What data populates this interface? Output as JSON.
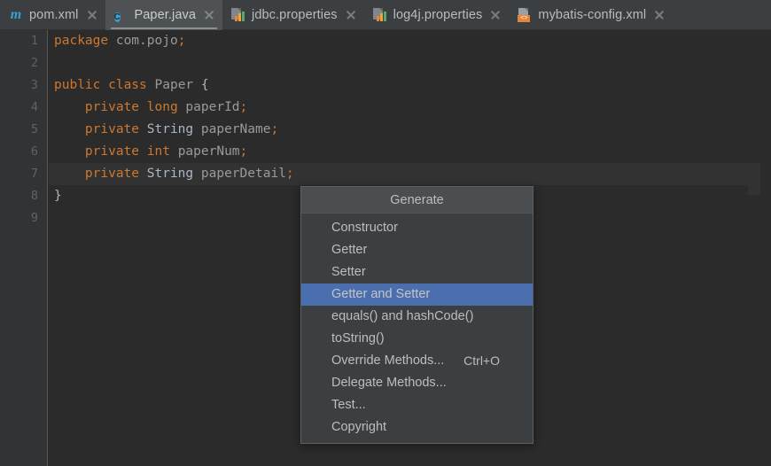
{
  "tabs": [
    {
      "label": "pom.xml",
      "icon": "maven-icon",
      "active": false
    },
    {
      "label": "Paper.java",
      "icon": "java-class-icon",
      "active": true
    },
    {
      "label": "jdbc.properties",
      "icon": "properties-icon",
      "active": false
    },
    {
      "label": "log4j.properties",
      "icon": "properties-icon",
      "active": false
    },
    {
      "label": "mybatis-config.xml",
      "icon": "xml-icon",
      "active": false
    }
  ],
  "editor": {
    "line_numbers": [
      "1",
      "2",
      "3",
      "4",
      "5",
      "6",
      "7",
      "8",
      "9"
    ],
    "current_line": 7,
    "lines": [
      {
        "n": "1",
        "text": "package com.pojo;"
      },
      {
        "n": "2",
        "text": ""
      },
      {
        "n": "3",
        "text": "public class Paper {"
      },
      {
        "n": "4",
        "text": "    private long paperId;"
      },
      {
        "n": "5",
        "text": "    private String paperName;"
      },
      {
        "n": "6",
        "text": "    private int paperNum;"
      },
      {
        "n": "7",
        "text": "    private String paperDetail;"
      },
      {
        "n": "8",
        "text": "}"
      },
      {
        "n": "9",
        "text": ""
      }
    ]
  },
  "popup": {
    "title": "Generate",
    "selected_index": 3,
    "items": [
      {
        "label": "Constructor",
        "shortcut": ""
      },
      {
        "label": "Getter",
        "shortcut": ""
      },
      {
        "label": "Setter",
        "shortcut": ""
      },
      {
        "label": "Getter and Setter",
        "shortcut": ""
      },
      {
        "label": "equals() and hashCode()",
        "shortcut": ""
      },
      {
        "label": "toString()",
        "shortcut": ""
      },
      {
        "label": "Override Methods...",
        "shortcut": "Ctrl+O"
      },
      {
        "label": "Delegate Methods...",
        "shortcut": ""
      },
      {
        "label": "Test...",
        "shortcut": ""
      },
      {
        "label": "Copyright",
        "shortcut": ""
      }
    ]
  },
  "icons": {
    "maven_glyph": "m",
    "class_glyph": "C",
    "xml_glyph": "<>"
  },
  "colors": {
    "tabbar_bg": "#3c3f41",
    "active_tab_bg": "#4e5254",
    "editor_bg": "#2b2b2b",
    "gutter_bg": "#313335",
    "current_line_bg": "#323232",
    "popup_bg": "#3c3f41",
    "popup_header_bg": "#4a4e50",
    "selection_blue": "#4b6eaf",
    "keyword_orange": "#cc7832",
    "identifier_gray": "#9a9a9a",
    "text_gray": "#a9b7c6"
  }
}
